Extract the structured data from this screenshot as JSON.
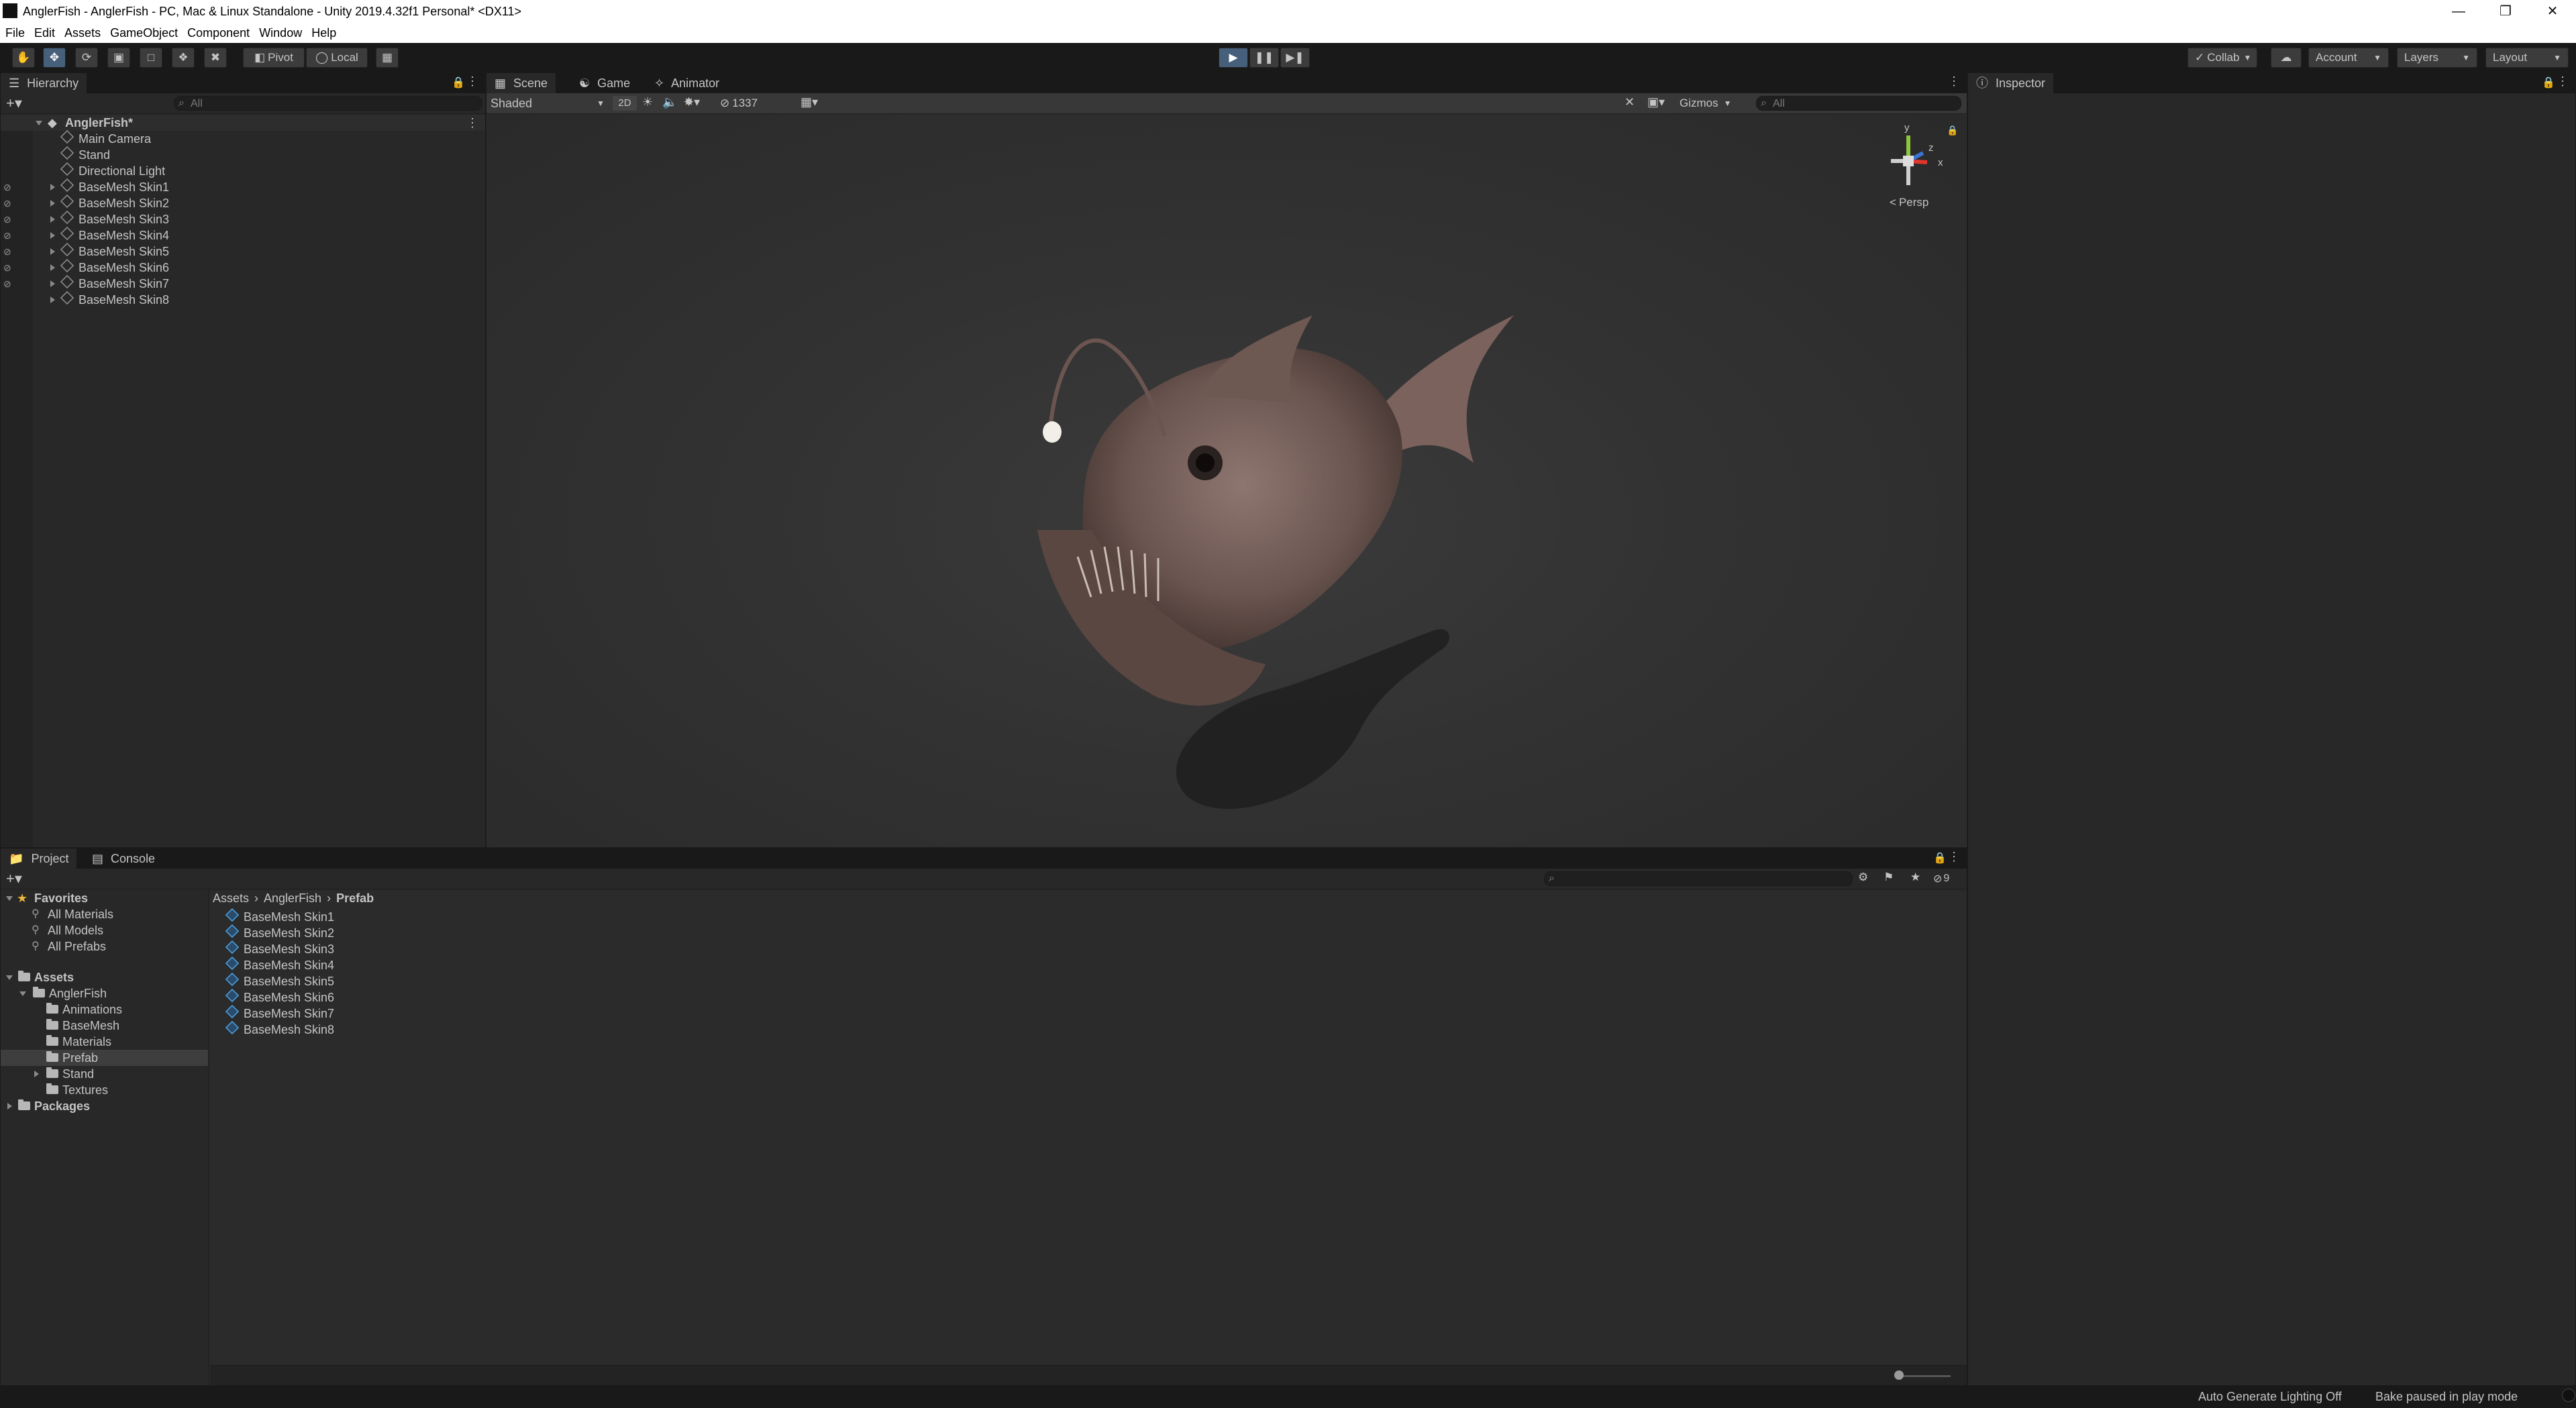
{
  "window": {
    "title": "AnglerFish - AnglerFish - PC, Mac & Linux Standalone - Unity 2019.4.32f1 Personal* <DX11>",
    "minimize": "—",
    "maximize": "❐",
    "close": "✕"
  },
  "menu": [
    "File",
    "Edit",
    "Assets",
    "GameObject",
    "Component",
    "Window",
    "Help"
  ],
  "toolbar": {
    "pivot": "Pivot",
    "local": "Local",
    "collab": "Collab",
    "account": "Account",
    "layers": "Layers",
    "layout": "Layout"
  },
  "hierarchy": {
    "tab": "Hierarchy",
    "search_placeholder": "All",
    "scene_name": "AnglerFish*",
    "items": [
      "Main Camera",
      "Stand",
      "Directional Light",
      "BaseMesh Skin1",
      "BaseMesh Skin2",
      "BaseMesh Skin3",
      "BaseMesh Skin4",
      "BaseMesh Skin5",
      "BaseMesh Skin6",
      "BaseMesh Skin7",
      "BaseMesh Skin8"
    ]
  },
  "scene": {
    "tabs": [
      "Scene",
      "Game",
      "Animator"
    ],
    "shading": "Shaded",
    "mode_2d": "2D",
    "hidden_count": "1337",
    "gizmos": "Gizmos",
    "search_placeholder": "All",
    "projection": "Persp",
    "axis_y": "y",
    "axis_z": "z",
    "axis_x": "x"
  },
  "inspector": {
    "tab": "Inspector"
  },
  "project": {
    "tabs": [
      "Project",
      "Console"
    ],
    "favorites_label": "Favorites",
    "favorites": [
      "All Materials",
      "All Models",
      "All Prefabs"
    ],
    "assets_label": "Assets",
    "anglerfish_folder": "AnglerFish",
    "subfolders": [
      "Animations",
      "BaseMesh",
      "Materials",
      "Prefab",
      "Stand",
      "Textures"
    ],
    "packages_label": "Packages",
    "breadcrumb": [
      "Assets",
      "AnglerFish",
      "Prefab"
    ],
    "files": [
      "BaseMesh Skin1",
      "BaseMesh Skin2",
      "BaseMesh Skin3",
      "BaseMesh Skin4",
      "BaseMesh Skin5",
      "BaseMesh Skin6",
      "BaseMesh Skin7",
      "BaseMesh Skin8"
    ],
    "hidden_count": "9"
  },
  "status": {
    "lighting": "Auto Generate Lighting Off",
    "bake": "Bake paused in play mode"
  },
  "colors": {
    "play_active": "#46607c",
    "prefab_blue": "#4b9bd8",
    "selected_row": "#3e3e3e"
  }
}
